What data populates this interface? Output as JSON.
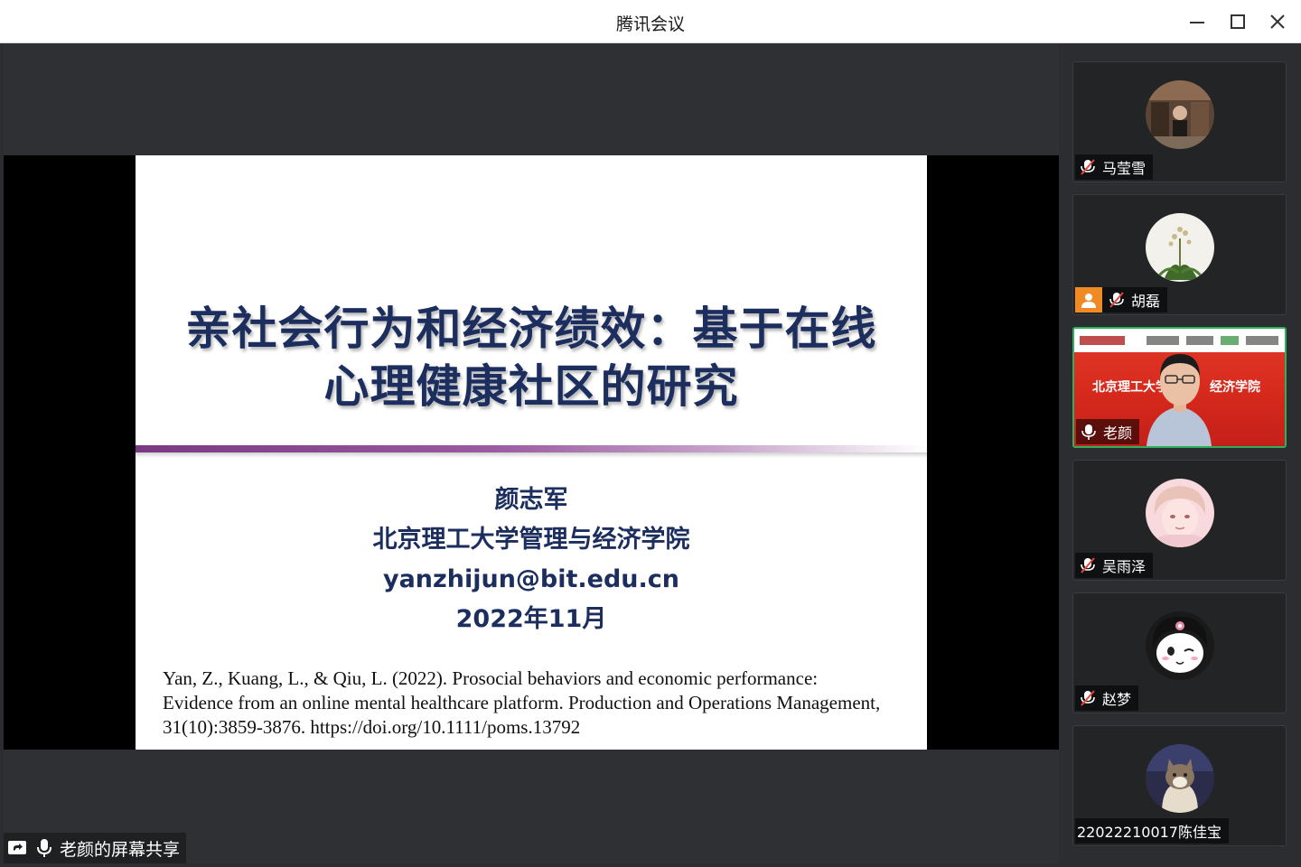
{
  "window": {
    "title": "腾讯会议"
  },
  "slide": {
    "title_line1": "亲社会行为和经济绩效：基于在线",
    "title_line2": "心理健康社区的研究",
    "author": "颜志军",
    "affiliation": "北京理工大学管理与经济学院",
    "email": "yanzhijun@bit.edu.cn",
    "date": "2022年11月",
    "reference_line1": "Yan, Z., Kuang, L., & Qiu, L. (2022). Prosocial behaviors and economic performance:",
    "reference_line2": "Evidence from an online mental healthcare platform. Production and Operations Management,",
    "reference_line3": "31(10):3859-3876. https://doi.org/10.1111/poms.13792"
  },
  "share_badge": {
    "label": "老颜的屏幕共享",
    "icons": [
      "screen-share-icon",
      "microphone-icon"
    ]
  },
  "participants": [
    {
      "name": "马莹雪",
      "mic": "muted",
      "avatar": "photo"
    },
    {
      "name": "胡磊",
      "mic": "muted",
      "avatar": "flower-photo",
      "host": true
    },
    {
      "name": "老颜",
      "mic": "on",
      "video": true,
      "background_text_left": "北京理工大学",
      "background_text_right": "经济学院",
      "active_speaker": true
    },
    {
      "name": "吴雨泽",
      "mic": "muted",
      "avatar": "anime-portrait"
    },
    {
      "name": "赵梦",
      "mic": "muted",
      "avatar": "kuromi-cartoon"
    },
    {
      "name": "22022210017陈佳宝",
      "mic": "none",
      "avatar": "cat-photo"
    }
  ],
  "colors": {
    "slide_text": "#1c2e5e",
    "accent_rule": "#7a3a82",
    "active_border": "#2fae5c",
    "host_badge": "#f08a24"
  }
}
